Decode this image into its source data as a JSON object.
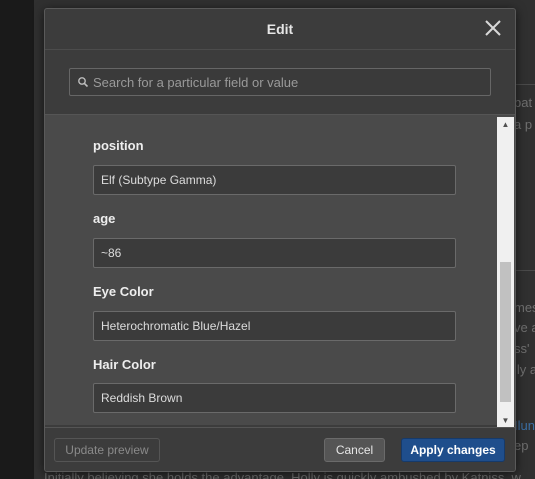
{
  "dialog": {
    "title": "Edit",
    "search_placeholder": "Search for a particular field or value"
  },
  "fields": [
    {
      "label": "position",
      "value": "Elf (Subtype Gamma)"
    },
    {
      "label": "age",
      "value": "~86"
    },
    {
      "label": "Eye Color",
      "value": "Heterochromatic Blue/Hazel"
    },
    {
      "label": "Hair Color",
      "value": "Reddish Brown"
    }
  ],
  "footer": {
    "preview_label": "Update preview",
    "cancel_label": "Cancel",
    "apply_label": "Apply changes"
  },
  "background_page": {
    "line_a": "bat",
    "line_b": "a p",
    "line_c": "mes",
    "line_d": "ve a",
    "line_e": "ss'",
    "line_f": "lly a",
    "link_fragment": "Ilun",
    "line_g": "ep",
    "bottom_line": "Initially believing she holds the advantage, Holly is quickly ambushed by Katniss, w"
  },
  "colors": {
    "apply_button": "#1f4e8c",
    "dialog_background": "#3c3c3c",
    "field_area": "#4a4a4a"
  }
}
